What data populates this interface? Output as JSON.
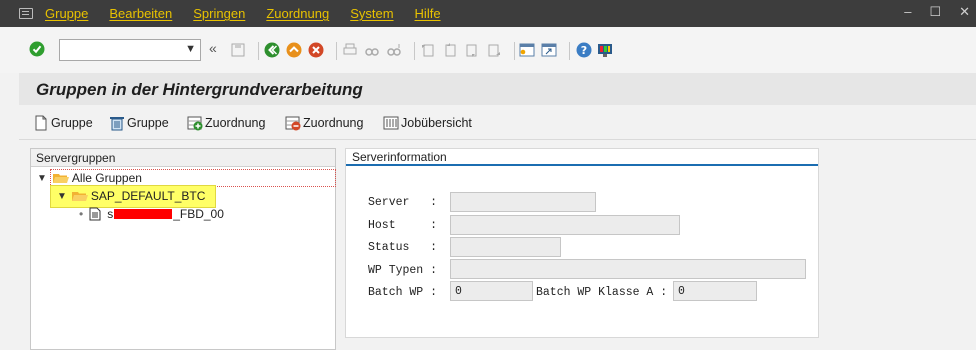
{
  "menu": {
    "items": [
      "Gruppe",
      "Bearbeiten",
      "Springen",
      "Zuordnung",
      "System",
      "Hilfe"
    ],
    "window_controls": [
      "minimize-icon",
      "maximize-icon",
      "close-icon"
    ]
  },
  "toolbar": {
    "command_field": {
      "value": "",
      "placeholder": ""
    },
    "icons": [
      "enter-icon",
      "back-icon",
      "exit-icon",
      "cancel-icon",
      "print-icon",
      "find-icon",
      "find-next-icon",
      "first-page-icon",
      "prev-page-icon",
      "next-page-icon",
      "last-page-icon",
      "new-session-icon",
      "shortcut-icon",
      "help-icon",
      "customize-layout-icon"
    ]
  },
  "page": {
    "title": "Gruppen in der Hintergrundverarbeitung"
  },
  "app_toolbar": {
    "create_group": "Gruppe",
    "delete_group": "Gruppe",
    "add_assignment": "Zuordnung",
    "remove_assignment": "Zuordnung",
    "job_overview": "Jobübersicht"
  },
  "tree": {
    "header": "Servergruppen",
    "root": "Alle Gruppen",
    "group": "SAP_DEFAULT_BTC",
    "server_visible_text": "s",
    "server_suffix": "_FBD_00",
    "highlight_color": "#ffff66"
  },
  "server_info": {
    "tab": "Serverinformation",
    "server_label": "Server   :",
    "host_label": "Host     :",
    "status_label": "Status   :",
    "wp_types_label": "WP Typen :",
    "batch_wp_label": "Batch WP :",
    "batch_wp_value": "0",
    "batch_class_label": "Batch WP Klasse A :",
    "batch_class_value": "0",
    "server_value": "",
    "host_value": "",
    "status_value": "",
    "wp_types_value": ""
  },
  "colors": {
    "menu_bg": "#3d3d3d",
    "menu_text": "#e8c200",
    "tab_accent": "#1b6db1"
  }
}
